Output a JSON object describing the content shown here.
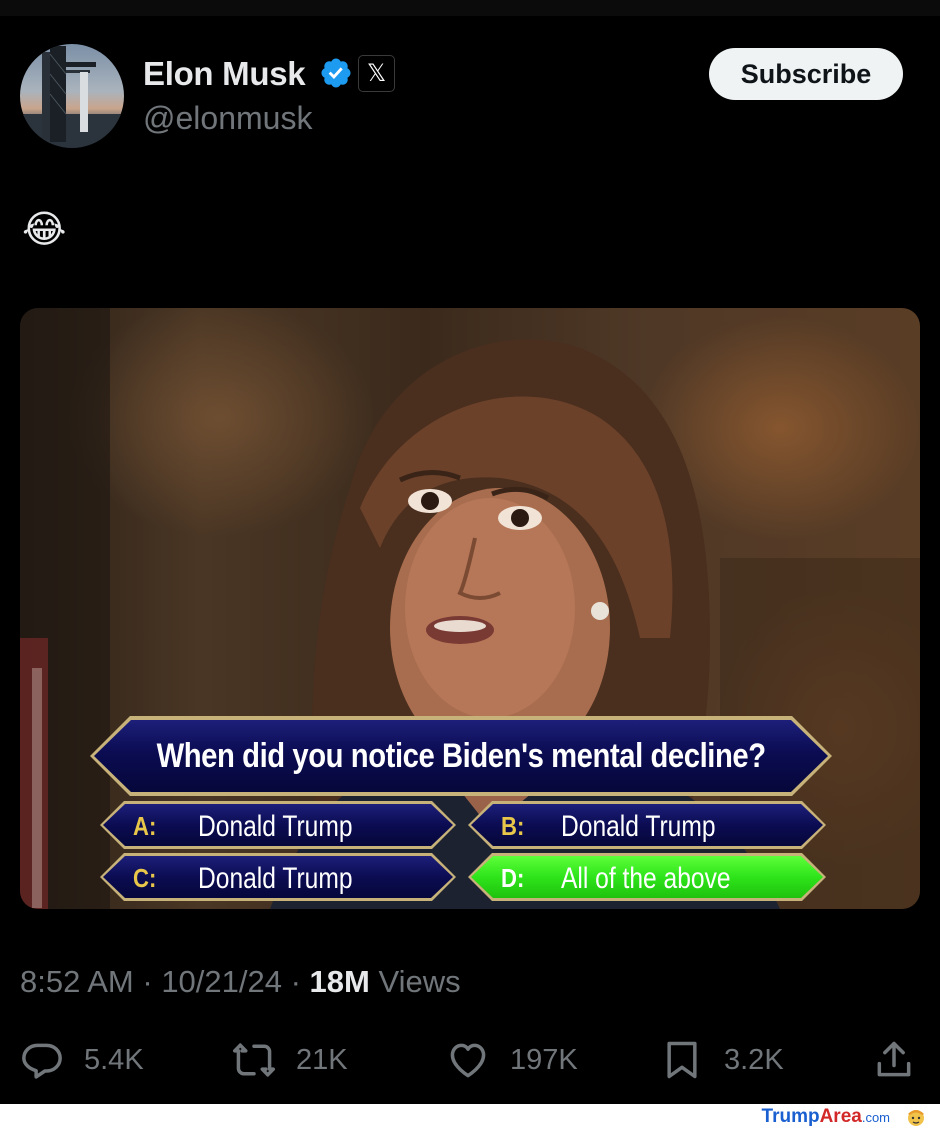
{
  "author": {
    "name": "Elon Musk",
    "handle": "@elonmusk",
    "verified_color": "#1d9bf0",
    "affiliate_badge": "𝕏"
  },
  "subscribe_label": "Subscribe",
  "tweet": {
    "text": "😂"
  },
  "media": {
    "question": "When did you notice Biden's mental decline?",
    "answers": [
      {
        "letter": "A:",
        "text": "Donald Trump",
        "correct": false
      },
      {
        "letter": "B:",
        "text": "Donald Trump",
        "correct": false
      },
      {
        "letter": "C:",
        "text": "Donald Trump",
        "correct": false
      },
      {
        "letter": "D:",
        "text": "All of the above",
        "correct": true
      }
    ]
  },
  "meta": {
    "time": "8:52 AM",
    "sep1": " · ",
    "date": "10/21/24",
    "sep2": " · ",
    "views_count": "18M",
    "views_label": " Views"
  },
  "actions": {
    "replies": "5.4K",
    "reposts": "21K",
    "likes": "197K",
    "bookmarks": "3.2K"
  },
  "watermark": {
    "part1": "Trump",
    "part2": "Area",
    "part3": ".com"
  },
  "colors": {
    "background": "#000000",
    "text_primary": "#e7e9ea",
    "text_secondary": "#71767b",
    "correct_answer": "#2ee41a",
    "quiz_blue": "#0b0c52",
    "quiz_gold": "#c7b27a"
  }
}
